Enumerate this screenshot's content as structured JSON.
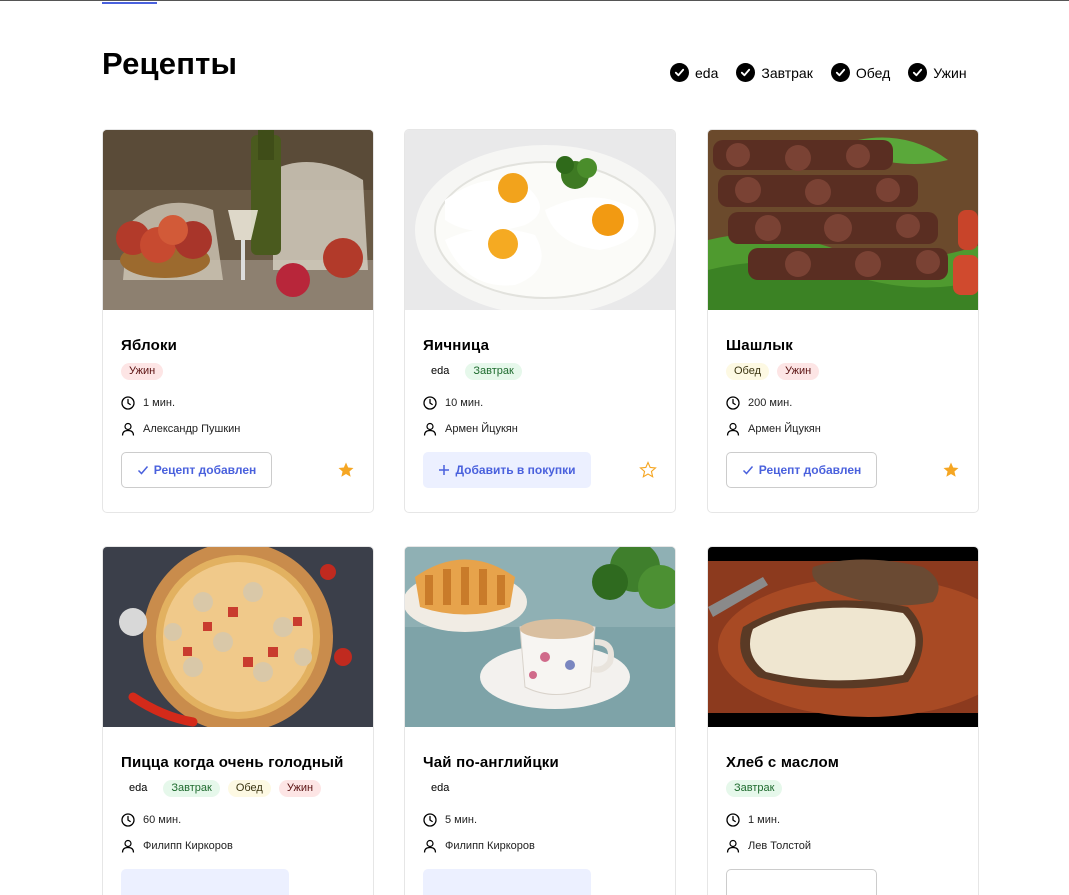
{
  "page": {
    "title": "Рецепты"
  },
  "filters": [
    {
      "label": "eda",
      "checked": true
    },
    {
      "label": "Завтрак",
      "checked": true
    },
    {
      "label": "Обед",
      "checked": true
    },
    {
      "label": "Ужин",
      "checked": true
    }
  ],
  "colors": {
    "accent": "#4a61dd",
    "star": "#f5a623",
    "tag_breakfast_bg": "#e6f8eb",
    "tag_lunch_bg": "#fdf9e3",
    "tag_dinner_bg": "#fde5e5"
  },
  "recipes": [
    {
      "title": "Яблоки",
      "tags": [
        "Ужин"
      ],
      "time": "1 мин.",
      "author": "Александр Пушкин",
      "button": "Рецепт добавлен",
      "button_state": "added",
      "favorite": true,
      "image": "apples-still-life"
    },
    {
      "title": "Яичница",
      "tags": [
        "eda",
        "Завтрак"
      ],
      "time": "10 мин.",
      "author": "Армен Йцукян",
      "button": "Добавить в покупки",
      "button_state": "add",
      "favorite": false,
      "image": "fried-eggs"
    },
    {
      "title": "Шашлык",
      "tags": [
        "Обед",
        "Ужин"
      ],
      "time": "200 мин.",
      "author": "Армен Йцукян",
      "button": "Рецепт добавлен",
      "button_state": "added",
      "favorite": true,
      "image": "shashlik-skewers"
    },
    {
      "title": "Пицца когда очень голодный",
      "tags": [
        "eda",
        "Завтрак",
        "Обед",
        "Ужин"
      ],
      "time": "60 мин.",
      "author": "Филипп Киркоров",
      "button": "",
      "button_state": "add",
      "favorite": false,
      "image": "pizza"
    },
    {
      "title": "Чай по-английцки",
      "tags": [
        "eda"
      ],
      "time": "5 мин.",
      "author": "Филипп Киркоров",
      "button": "",
      "button_state": "add",
      "favorite": false,
      "image": "tea-with-milk"
    },
    {
      "title": "Хлеб с маслом",
      "tags": [
        "Завтрак"
      ],
      "time": "1 мин.",
      "author": "Лев Толстой",
      "button": "",
      "button_state": "added",
      "favorite": false,
      "image": "bread-butter"
    }
  ]
}
